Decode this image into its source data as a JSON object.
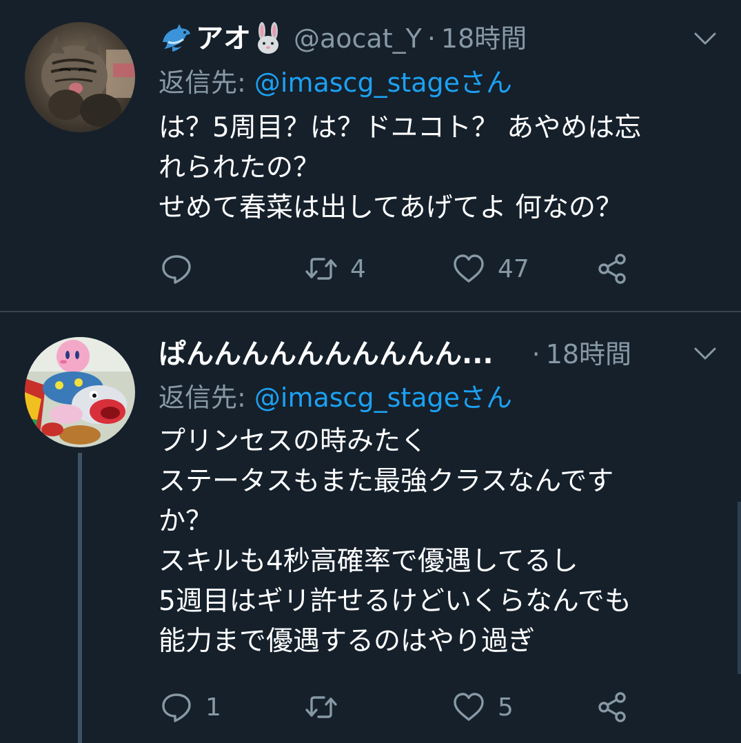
{
  "colors": {
    "background": "#15202b",
    "text_primary": "#ffffff",
    "text_secondary": "#8899a6",
    "link": "#1da1f2",
    "divider": "#38444d",
    "thread_line": "#3d5466"
  },
  "tweets": [
    {
      "display_name": "アオ",
      "name_emoji_before": "dolphin-emoji",
      "name_emoji_after": "rabbit-face-emoji",
      "handle": "@aocat_Y",
      "dot": "·",
      "time": "18時間",
      "reply_prefix": "返信先: ",
      "reply_mention": "@imascg_stageさん",
      "body": [
        "は？5周目？は？ドユコト？ あやめは忘",
        "れられたの？",
        "せめて春菜は出してあげてよ 何なの？"
      ],
      "reply_count": "",
      "retweet_count": "4",
      "like_count": "47",
      "avatar": "cat-photo"
    },
    {
      "display_name": "ぱんんんんんんんんんん...",
      "handle": "",
      "dot": "·",
      "time": "18時間",
      "reply_prefix": "返信先: ",
      "reply_mention": "@imascg_stageさん",
      "body": [
        "プリンセスの時みたく",
        "ステータスもまた最強クラスなんです",
        "か？",
        "スキルも4秒高確率で優遇してるし",
        "5週目はギリ許せるけどいくらなんでも",
        "能力まで優遇するのはやり過ぎ"
      ],
      "reply_count": "1",
      "retweet_count": "",
      "like_count": "5",
      "avatar": "kirby-figure-photo"
    }
  ]
}
